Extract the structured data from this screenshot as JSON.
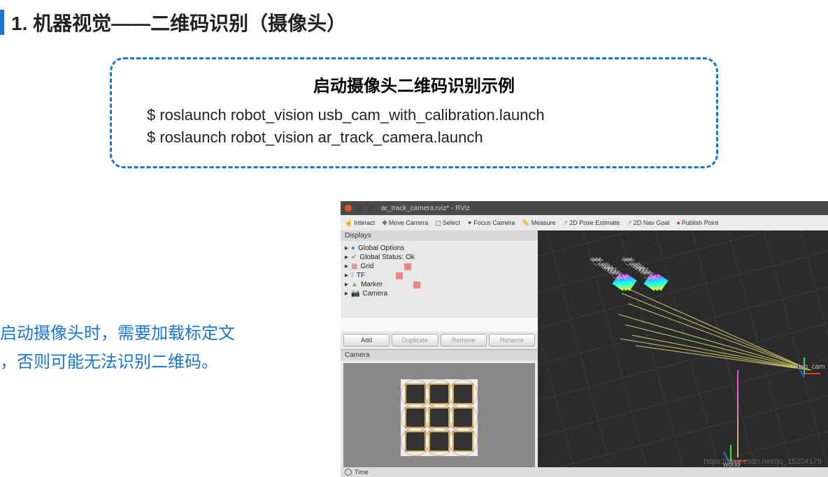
{
  "header": {
    "title": "1. 机器视觉——二维码识别（摄像头）"
  },
  "box": {
    "title": "启动摄像头二维码识别示例",
    "cmd1": "$ roslaunch robot_vision usb_cam_with_calibration.launch",
    "cmd2": "$ roslaunch robot_vision ar_track_camera.launch"
  },
  "note_line1": "启动摄像头时，需要加载标定文",
  "note_line2": "，否则可能无法识别二维码。",
  "rviz": {
    "title": "ar_track_camera.rviz* - RViz",
    "toolbar": {
      "interact": "Interact",
      "move": "Move Camera",
      "select": "Select",
      "focus": "Focus Camera",
      "measure": "Measure",
      "pose": "2D Pose Estimate",
      "nav": "2D Nav Goal",
      "publish": "Publish Point"
    },
    "displays": {
      "header": "Displays",
      "items": [
        "Global Options",
        "Global Status: Ok",
        "Grid",
        "TF",
        "Marker",
        "Camera"
      ]
    },
    "buttons": {
      "add": "Add",
      "duplicate": "Duplicate",
      "remove": "Remove",
      "rename": "Rename"
    },
    "camera_panel": "Camera",
    "frames": {
      "usb": "usb_cam",
      "world": "world"
    },
    "markers": [
      "ar_marker_6",
      "ar_marker_0",
      "ar_marker_7",
      "ar_marker_4",
      "ar_marker_8",
      "ar_marker_2"
    ],
    "time": "Time"
  },
  "watermark": "https://blog.csdn.net/qq_15204179"
}
